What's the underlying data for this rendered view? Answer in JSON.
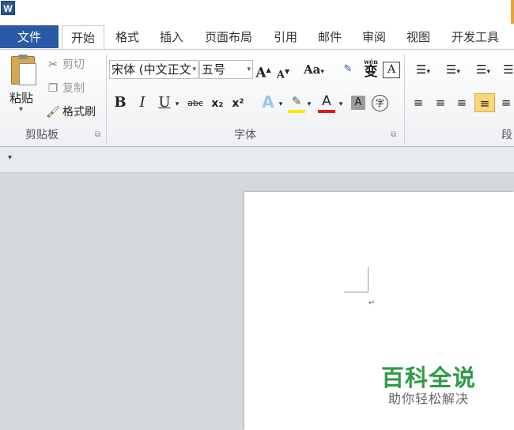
{
  "app": {
    "icon_letter": "W"
  },
  "tabs": [
    {
      "label": "文件"
    },
    {
      "label": "开始"
    },
    {
      "label": "格式"
    },
    {
      "label": "插入"
    },
    {
      "label": "页面布局"
    },
    {
      "label": "引用"
    },
    {
      "label": "邮件"
    },
    {
      "label": "审阅"
    },
    {
      "label": "视图"
    },
    {
      "label": "开发工具"
    }
  ],
  "clipboard": {
    "paste": "粘贴",
    "cut": "剪切",
    "copy": "复制",
    "format_painter": "格式刷",
    "group_label": "剪贴板"
  },
  "font": {
    "font_name": "宋体 (中文正文",
    "font_size": "五号",
    "group_label": "字体",
    "grow": "A",
    "shrink": "A",
    "case": "Aa",
    "phonetic": "wén",
    "phonetic_char": "变",
    "border_char": "A",
    "bold": "B",
    "italic": "I",
    "underline": "U",
    "strike": "abc",
    "subscript": "x₂",
    "superscript": "x²",
    "effect": "A",
    "font_color": "A",
    "shading": "A",
    "enclose": "字"
  },
  "paragraph": {
    "group_label": "段"
  },
  "watermark": {
    "title": "百科全说",
    "subtitle": "助你轻松解决"
  },
  "colors": {
    "file_tab": "#2a5aa6",
    "highlight": "#ffe600",
    "font_color": "#e31b1b",
    "watermark": "#2e9b47"
  }
}
